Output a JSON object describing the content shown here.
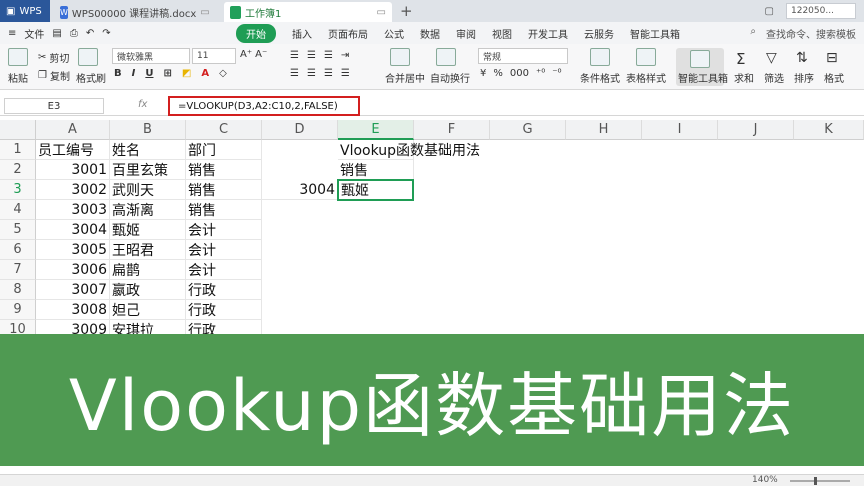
{
  "titlebar": {
    "wps_label": "WPS",
    "doc_tab": "WPS00000 课程讲稿.docx",
    "sheet_tab": "工作簿1",
    "account": "122050..."
  },
  "menubar": {
    "file": "文件",
    "tabs": [
      "开始",
      "插入",
      "页面布局",
      "公式",
      "数据",
      "审阅",
      "视图",
      "开发工具",
      "云服务",
      "智能工具箱"
    ],
    "search_hint": "查找命令、搜索模板"
  },
  "ribbon": {
    "cut": "剪切",
    "copy": "复制",
    "paste": "粘贴",
    "format_painter": "格式刷",
    "font_name": "微软雅黑",
    "font_size": "11",
    "merge_center": "合并居中",
    "wrap_text": "自动换行",
    "number_format": "常规",
    "conditional_format": "条件格式",
    "table_style": "表格样式",
    "smart_toolbox": "智能工具箱",
    "sum": "求和",
    "filter": "筛选",
    "sort": "排序",
    "format": "格式"
  },
  "formula_bar": {
    "cell_ref": "E3",
    "fx": "fx",
    "formula": "=VLOOKUP(D3,A2:C10,2,FALSE)"
  },
  "sheet": {
    "columns": [
      "A",
      "B",
      "C",
      "D",
      "E",
      "F",
      "G",
      "H",
      "I",
      "J",
      "K"
    ],
    "rows": [
      "1",
      "2",
      "3",
      "4",
      "5",
      "6",
      "7",
      "8",
      "9",
      "10"
    ],
    "table": [
      [
        "员工编号",
        "姓名",
        "部门"
      ],
      [
        "3001",
        "百里玄策",
        "销售"
      ],
      [
        "3002",
        "武则天",
        "销售"
      ],
      [
        "3003",
        "高渐离",
        "销售"
      ],
      [
        "3004",
        "甄姬",
        "会计"
      ],
      [
        "3005",
        "王昭君",
        "会计"
      ],
      [
        "3006",
        "扁鹊",
        "会计"
      ],
      [
        "3007",
        "嬴政",
        "行政"
      ],
      [
        "3008",
        "妲己",
        "行政"
      ],
      [
        "3009",
        "安琪拉",
        "行政"
      ]
    ],
    "e1": "Vlookup函数基础用法",
    "e2": "销售",
    "d3": "3004",
    "e3": "甄姬"
  },
  "banner": {
    "text": "Vlookup函数基础用法"
  },
  "statusbar": {
    "zoom": "140%"
  },
  "colors": {
    "accent_green": "#1f9d55",
    "banner_green": "#4f9a52",
    "highlight_red": "#d31f1f"
  }
}
